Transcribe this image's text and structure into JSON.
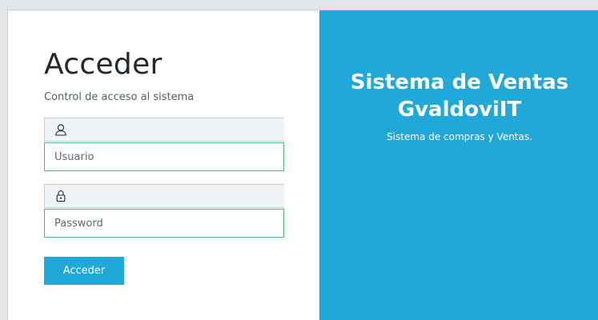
{
  "login": {
    "title": "Acceder",
    "subtitle": "Control de acceso al sistema",
    "username": {
      "icon": "user-icon",
      "placeholder": "Usuario",
      "value": ""
    },
    "password": {
      "icon": "lock-icon",
      "placeholder": "Password",
      "value": ""
    },
    "submit_label": "Acceder"
  },
  "brand": {
    "title_line1": "Sistema de Ventas",
    "title_line2": "GvaldoviIT",
    "description": "Sistema de compras y Ventas."
  },
  "colors": {
    "accent": "#20a8d8",
    "valid_border": "#4dbd74",
    "background": "#e4e5e6"
  }
}
